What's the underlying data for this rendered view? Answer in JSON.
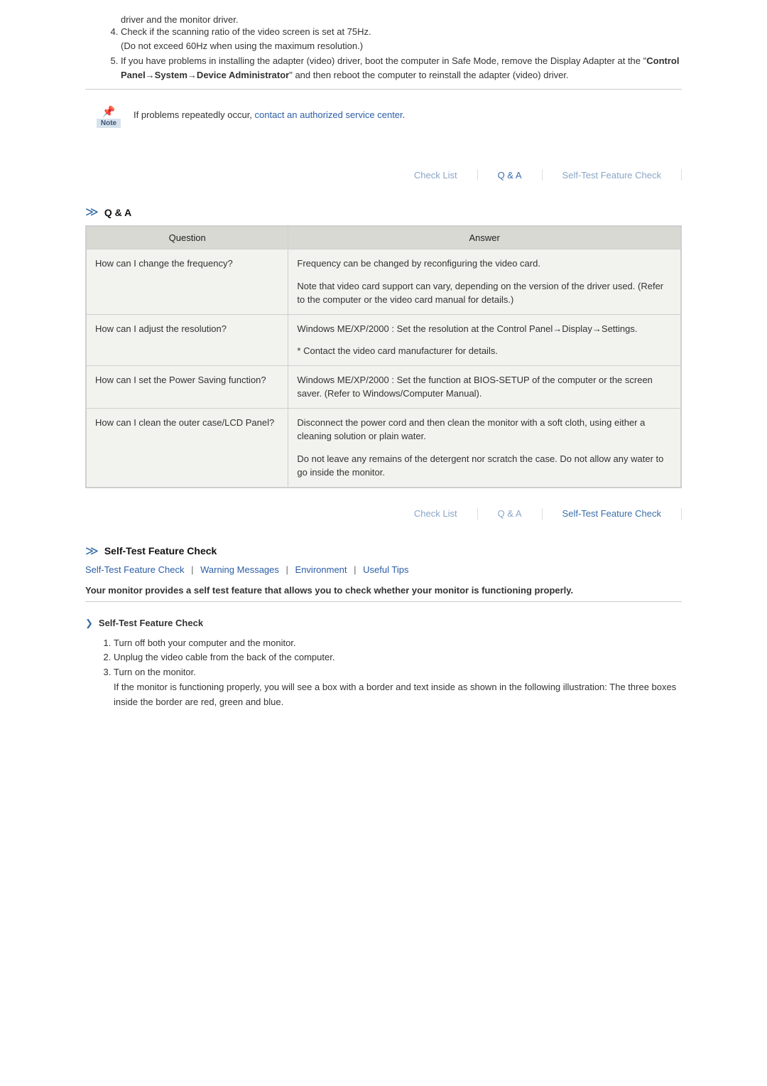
{
  "intro": {
    "pre_item": "driver and the monitor driver.",
    "item4_line1": "Check if the scanning ratio of the video screen is set at 75Hz.",
    "item4_line2": "(Do not exceed 60Hz when using the maximum resolution.)",
    "item5_pre": "If you have problems in installing the adapter (video) driver, boot the computer in Safe Mode, remove the Display Adapter at the \"",
    "item5_bold": "Control Panel→System→Device Administrator",
    "item5_post": "\" and then reboot the computer to reinstall the adapter (video) driver."
  },
  "note": {
    "label": "Note",
    "text_pre": "If problems repeatedly occur, ",
    "link": "contact an authorized service center",
    "text_post": "."
  },
  "nav": {
    "check_list": "Check List",
    "qa": "Q & A",
    "self_test": "Self-Test Feature Check"
  },
  "qa_section": {
    "title": "Q & A",
    "headers": {
      "question": "Question",
      "answer": "Answer"
    },
    "rows": [
      {
        "q": "How can I change the frequency?",
        "a1": "Frequency can be changed by reconfiguring the video card.",
        "a2": "Note that video card support can vary, depending on the version of the driver used. (Refer to the computer or the video card manual for details.)"
      },
      {
        "q": "How can I adjust the resolution?",
        "a1": "Windows ME/XP/2000 : Set the resolution at the Control Panel→Display→Settings.",
        "a2": "* Contact the video card manufacturer for details."
      },
      {
        "q": "How can I set the Power Saving function?",
        "a1": "Windows ME/XP/2000 : Set the function at BIOS-SETUP of the computer or the screen saver. (Refer to Windows/Computer Manual).",
        "a2": ""
      },
      {
        "q": "How can I clean the outer case/LCD Panel?",
        "a1": "Disconnect the power cord and then clean the monitor with a soft cloth, using either a cleaning solution or plain water.",
        "a2": "Do not leave any remains of the detergent nor scratch the case. Do not allow any water to go inside the monitor."
      }
    ]
  },
  "selftest_section": {
    "title": "Self-Test Feature Check",
    "sublinks": {
      "l1": "Self-Test Feature Check",
      "l2": "Warning Messages",
      "l3": "Environment",
      "l4": "Useful Tips"
    },
    "bold": "Your monitor provides a self test feature that allows you to check whether your monitor is functioning properly.",
    "sub_h": "Self-Test Feature Check",
    "steps": {
      "s1": "Turn off both your computer and the monitor.",
      "s2": "Unplug the video cable from the back of the computer.",
      "s3_a": "Turn on the monitor.",
      "s3_b": "If the monitor is functioning properly, you will see a box with a border and text inside as shown in the following illustration: The three boxes inside the border are red, green and blue."
    }
  }
}
